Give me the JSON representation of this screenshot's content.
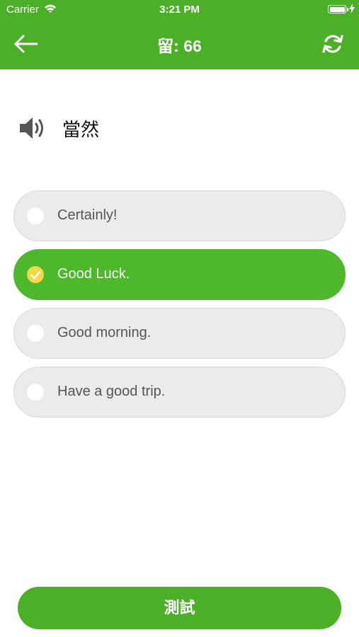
{
  "status_bar": {
    "carrier": "Carrier",
    "time": "3:21 PM"
  },
  "header": {
    "title": "留: 66",
    "back_icon": "arrow-left-icon",
    "refresh_icon": "refresh-icon"
  },
  "prompt": {
    "speaker_icon": "speaker-icon",
    "word": "當然"
  },
  "options": [
    {
      "label": "Certainly!",
      "selected": false
    },
    {
      "label": "Good Luck.",
      "selected": true
    },
    {
      "label": "Good morning.",
      "selected": false
    },
    {
      "label": "Have a good trip.",
      "selected": false
    }
  ],
  "test_button": {
    "label": "測試"
  },
  "colors": {
    "brand_green": "#4caf28",
    "selected_green": "#4cb82a",
    "check_yellow": "#f4d84a",
    "option_bg": "#ebebeb"
  }
}
